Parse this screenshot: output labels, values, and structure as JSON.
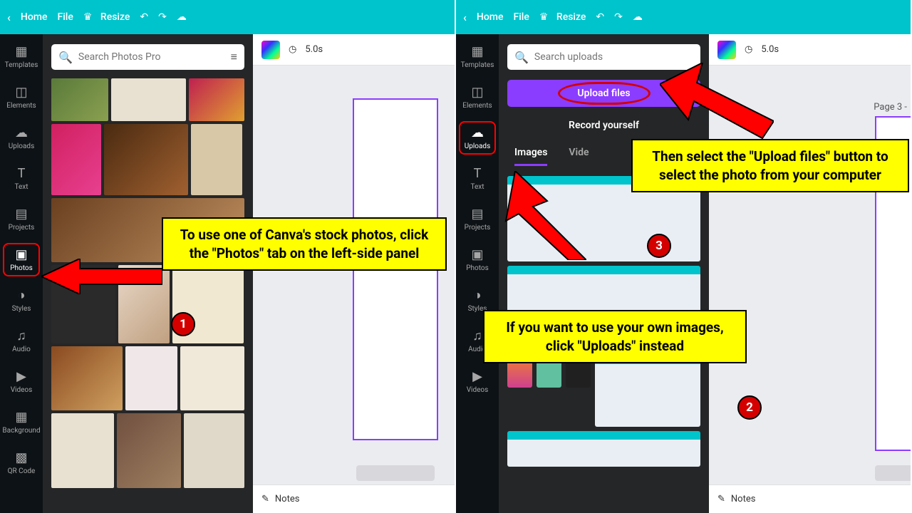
{
  "left": {
    "topbar": {
      "home": "Home",
      "file": "File",
      "resize": "Resize"
    },
    "sidenav": {
      "templates": "Templates",
      "elements": "Elements",
      "uploads": "Uploads",
      "text": "Text",
      "projects": "Projects",
      "photos": "Photos",
      "styles": "Styles",
      "audio": "Audio",
      "videos": "Videos",
      "background": "Background",
      "qr": "QR Code"
    },
    "search": {
      "placeholder": "Search Photos Pro"
    },
    "active_tab": "photos",
    "canvas": {
      "duration": "5.0s",
      "notes": "Notes"
    },
    "callout": {
      "text": "To use one of Canva's stock photos, click the \"Photos\" tab on the left-side panel",
      "num": "1"
    }
  },
  "right": {
    "topbar": {
      "home": "Home",
      "file": "File",
      "resize": "Resize"
    },
    "sidenav": {
      "templates": "Templates",
      "elements": "Elements",
      "uploads": "Uploads",
      "text": "Text",
      "projects": "Projects",
      "photos": "Photos",
      "styles": "Styles",
      "audio": "Audio",
      "videos": "Videos"
    },
    "search": {
      "placeholder": "Search uploads"
    },
    "upload_btn": "Upload files",
    "record": "Record yourself",
    "tabs": {
      "images": "Images",
      "videos": "Vide"
    },
    "active_tab": "uploads",
    "canvas": {
      "duration": "5.0s",
      "notes": "Notes",
      "page": "Page 3 -"
    },
    "callout_upload": {
      "text": "Then select the \"Upload files\" button to select the photo from your computer",
      "num": "3"
    },
    "callout_own": {
      "text": "If you want to use your own images, click \"Uploads\" instead",
      "num": "2"
    }
  }
}
